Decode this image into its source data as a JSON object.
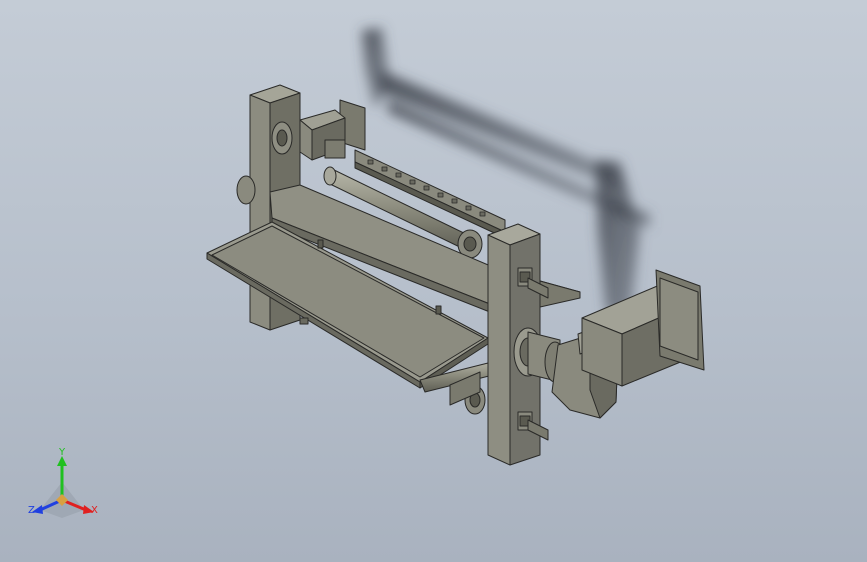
{
  "viewport": {
    "background_top": "#c4ccd6",
    "background_bottom": "#a9b2bf",
    "model_color": "#8e8e80",
    "edge_color": "#2a2a28"
  },
  "triad": {
    "x_label": "X",
    "y_label": "Y",
    "z_label": "Z",
    "x_color": "#e02020",
    "y_color": "#20c020",
    "z_color": "#2040e0"
  }
}
